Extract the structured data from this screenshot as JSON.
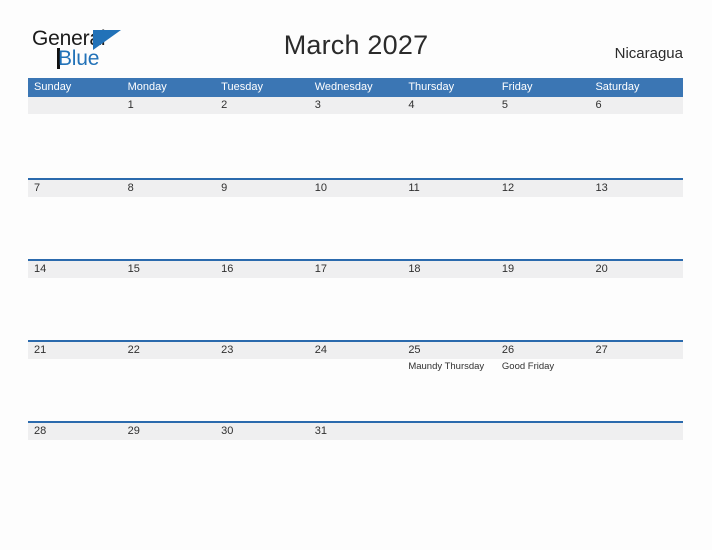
{
  "brand": {
    "name_part1": "General",
    "name_part2": "Blue",
    "flag_icon": "flag-triangle-icon",
    "accent_color": "#2272b8"
  },
  "header": {
    "title": "March 2027",
    "country": "Nicaragua"
  },
  "colors": {
    "header_blue": "#3b76b4",
    "row_rule_blue": "#2b6aad",
    "band_gray": "#efeff0",
    "page_background": "#fdfdfd",
    "text": "#303030"
  },
  "calendar": {
    "month": "March",
    "year": "2027",
    "weekday_headers": [
      "Sunday",
      "Monday",
      "Tuesday",
      "Wednesday",
      "Thursday",
      "Friday",
      "Saturday"
    ],
    "weeks": [
      {
        "days": [
          {
            "num": "",
            "events": []
          },
          {
            "num": "1",
            "events": []
          },
          {
            "num": "2",
            "events": []
          },
          {
            "num": "3",
            "events": []
          },
          {
            "num": "4",
            "events": []
          },
          {
            "num": "5",
            "events": []
          },
          {
            "num": "6",
            "events": []
          }
        ]
      },
      {
        "days": [
          {
            "num": "7",
            "events": []
          },
          {
            "num": "8",
            "events": []
          },
          {
            "num": "9",
            "events": []
          },
          {
            "num": "10",
            "events": []
          },
          {
            "num": "11",
            "events": []
          },
          {
            "num": "12",
            "events": []
          },
          {
            "num": "13",
            "events": []
          }
        ]
      },
      {
        "days": [
          {
            "num": "14",
            "events": []
          },
          {
            "num": "15",
            "events": []
          },
          {
            "num": "16",
            "events": []
          },
          {
            "num": "17",
            "events": []
          },
          {
            "num": "18",
            "events": []
          },
          {
            "num": "19",
            "events": []
          },
          {
            "num": "20",
            "events": []
          }
        ]
      },
      {
        "days": [
          {
            "num": "21",
            "events": []
          },
          {
            "num": "22",
            "events": []
          },
          {
            "num": "23",
            "events": []
          },
          {
            "num": "24",
            "events": []
          },
          {
            "num": "25",
            "events": [
              "Maundy Thursday"
            ]
          },
          {
            "num": "26",
            "events": [
              "Good Friday"
            ]
          },
          {
            "num": "27",
            "events": []
          }
        ]
      },
      {
        "days": [
          {
            "num": "28",
            "events": []
          },
          {
            "num": "29",
            "events": []
          },
          {
            "num": "30",
            "events": []
          },
          {
            "num": "31",
            "events": []
          },
          {
            "num": "",
            "events": []
          },
          {
            "num": "",
            "events": []
          },
          {
            "num": "",
            "events": []
          }
        ]
      }
    ]
  }
}
